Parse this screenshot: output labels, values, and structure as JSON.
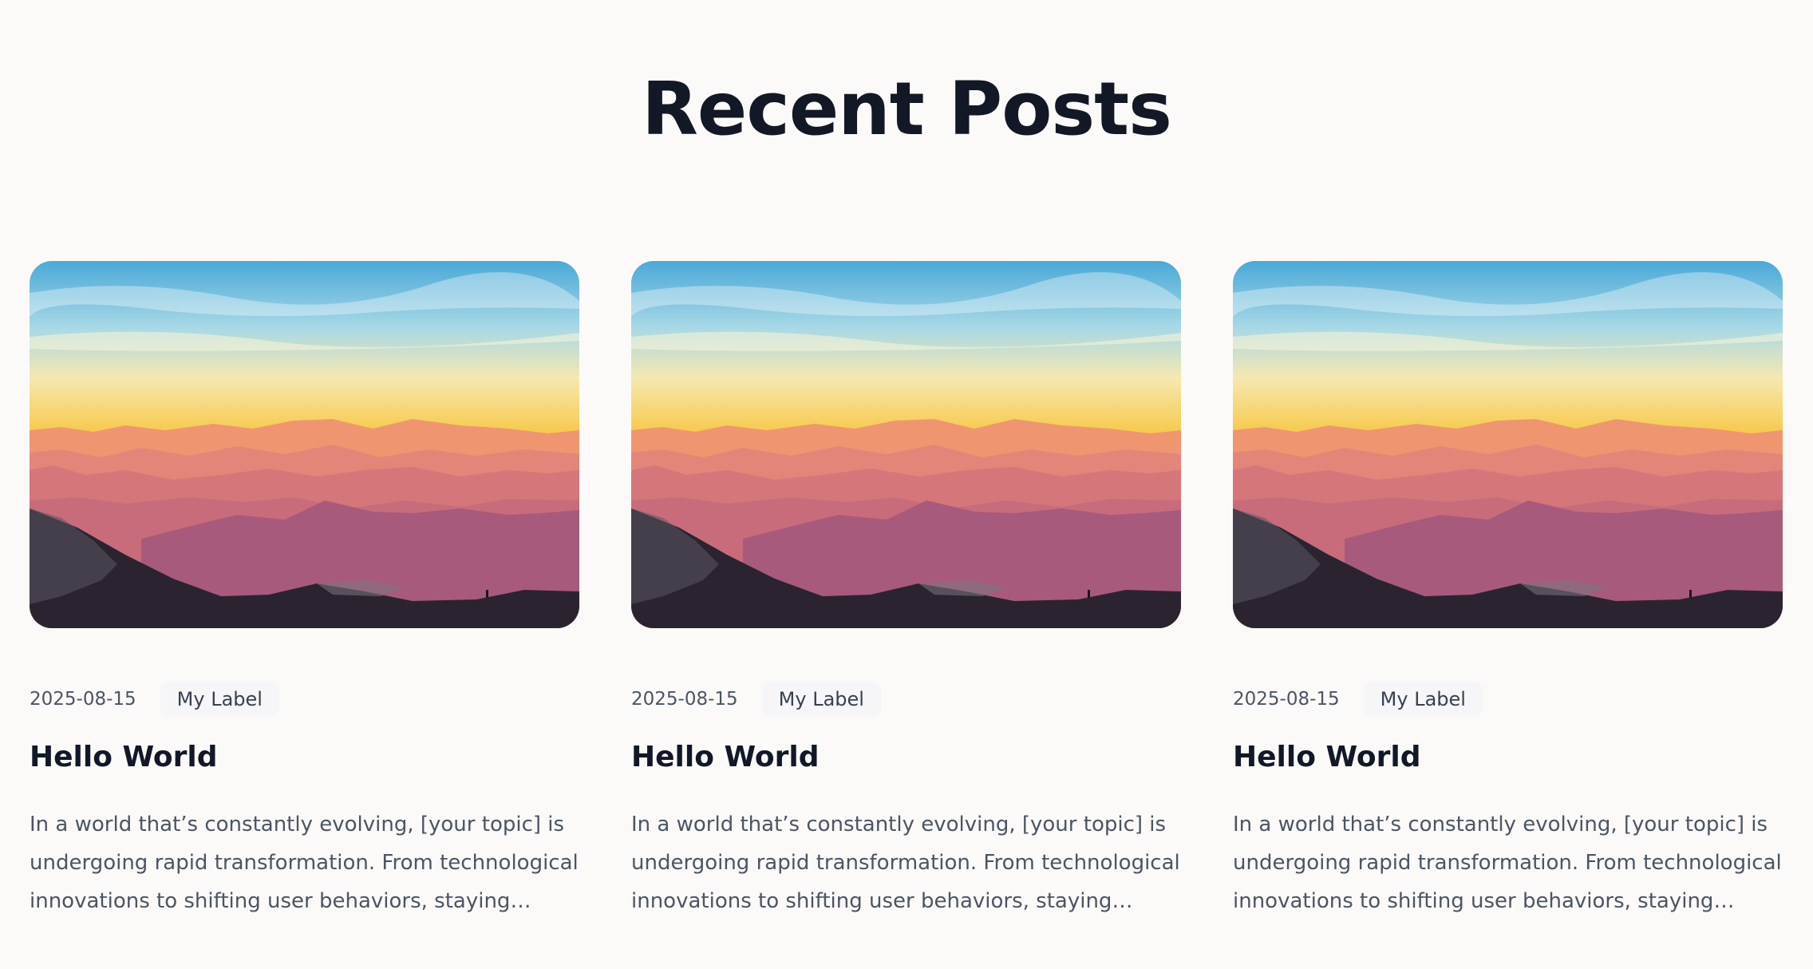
{
  "section": {
    "title": "Recent Posts"
  },
  "posts": [
    {
      "date": "2025-08-15",
      "label": "My Label",
      "title": "Hello World",
      "excerpt": "In a world that’s constantly evolving, [your topic] is undergoing rapid transformation. From technological innovations to shifting user behaviors, staying ahead of the curve is more important than ever."
    },
    {
      "date": "2025-08-15",
      "label": "My Label",
      "title": "Hello World",
      "excerpt": "In a world that’s constantly evolving, [your topic] is undergoing rapid transformation. From technological innovations to shifting user behaviors, staying ahead of the curve is more important than ever."
    },
    {
      "date": "2025-08-15",
      "label": "My Label",
      "title": "Hello World",
      "excerpt": "In a world that’s constantly evolving, [your topic] is undergoing rapid transformation. From technological innovations to shifting user behaviors, staying ahead of the curve is more important than ever."
    }
  ],
  "colors": {
    "background": "#fcfaf9",
    "heading": "#121826",
    "body_text": "#4b5563",
    "label_bg": "#f6f6f8"
  }
}
